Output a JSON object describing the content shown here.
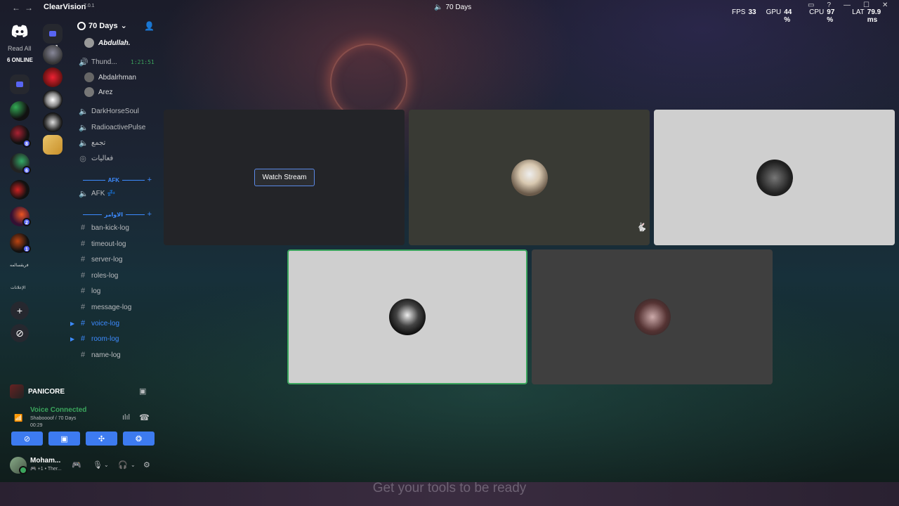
{
  "app": {
    "name": "ClearVision",
    "version": "7.0.1",
    "window_title": "70 Days"
  },
  "stats": {
    "fps_label": "FPS",
    "fps": "33",
    "gpu_label": "GPU",
    "gpu": "44 %",
    "cpu_label": "CPU",
    "cpu": "97 %",
    "lat_label": "LAT",
    "lat": "79.9 ms"
  },
  "rail": {
    "read_all": "Read All",
    "online": "6 ONLINE",
    "text_a": "فريقسالمه",
    "text_b": "الإعلانات",
    "badges": [
      "8",
      "6",
      "2",
      "1"
    ]
  },
  "channels": {
    "server_name": "70 Days",
    "items": [
      {
        "name": "Abdullah.",
        "type": "user"
      },
      {
        "name": "Thund...",
        "type": "voice",
        "timer": "1:21:51"
      },
      {
        "name": "Abdalrhman",
        "type": "user"
      },
      {
        "name": "Arez",
        "type": "user"
      },
      {
        "name": "DarkHorseSoul",
        "type": "voice"
      },
      {
        "name": "RadioactivePulse",
        "type": "voice"
      },
      {
        "name": "تجمع",
        "type": "voice"
      },
      {
        "name": "فعاليات",
        "type": "stage"
      },
      {
        "name": "AFK 💤",
        "type": "voice"
      },
      {
        "name": "ban-kick-log",
        "type": "text"
      },
      {
        "name": "timeout-log",
        "type": "text"
      },
      {
        "name": "server-log",
        "type": "text"
      },
      {
        "name": "roles-log",
        "type": "text"
      },
      {
        "name": "log",
        "type": "text"
      },
      {
        "name": "message-log",
        "type": "text"
      },
      {
        "name": "voice-log",
        "type": "text"
      },
      {
        "name": "room-log",
        "type": "text"
      },
      {
        "name": "name-log",
        "type": "text"
      }
    ],
    "categories": [
      "AFK",
      "الاوامر"
    ]
  },
  "activity": {
    "name": "PANICORE"
  },
  "voice": {
    "status": "Voice Connected",
    "where": "Shaboooof / 70 Days",
    "time": "00:29"
  },
  "user": {
    "name": "Moham...",
    "status": "🎮 +1 • Ther..."
  },
  "stream": {
    "watch_label": "Watch Stream"
  },
  "caption": "Get your tools to be ready",
  "colors": {
    "accent": "#3d7bf0",
    "connected": "#3ba55d",
    "speaking_border": "#3ba55d"
  }
}
